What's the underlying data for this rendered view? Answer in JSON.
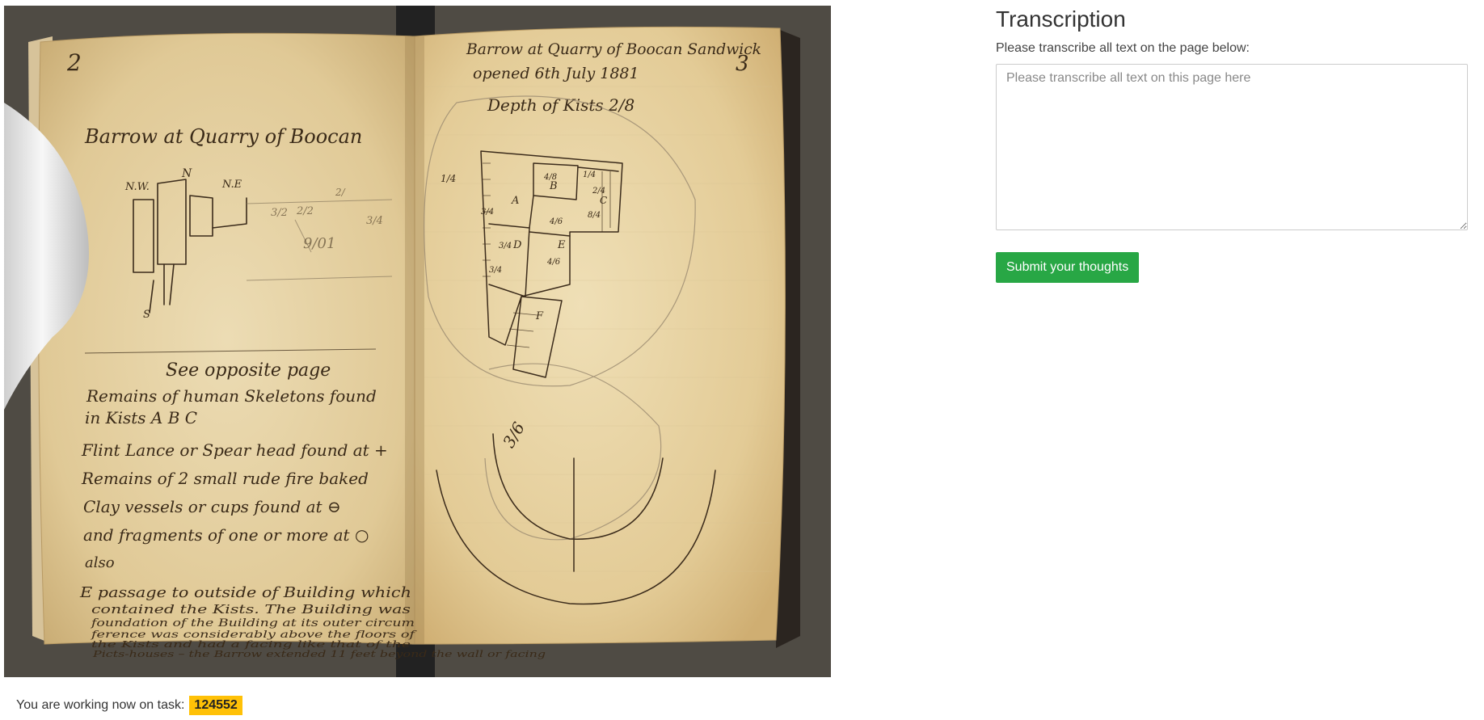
{
  "panel": {
    "title": "Transcription",
    "instructions": "Please transcribe all text on the page below:",
    "textarea_placeholder": "Please transcribe all text on this page here",
    "textarea_value": "",
    "submit_label": "Submit your thoughts"
  },
  "footer": {
    "working_label": "You are working now on task:",
    "task_id": "124552"
  },
  "manuscript": {
    "left_page": {
      "page_number": "2",
      "heading": "Barrow at Quarry of Boocan",
      "compass": [
        "N.W.",
        "N",
        "N.E",
        "S"
      ],
      "sketch_marks": [
        "2/",
        "3/2",
        "2/2",
        "3/4",
        "9/01"
      ],
      "see_note": "See opposite page",
      "notes": [
        "Remains of human Skeletons found",
        "in Kists A B C",
        "Flint Lance or Spear head found at +",
        "Remains of 2 small rude fire baked",
        "Clay vessels or cups found at ⊖",
        "and fragments of one or more at ○",
        "also",
        "E passage to outside of Building which",
        "contained the Kists. The Building was",
        "foundation of the Building at its outer circum",
        "ference was considerably above the floors of",
        "the Kists and had a facing like that of the",
        "Picts-houses – the Barrow extended 11 feet beyond the wall or facing"
      ]
    },
    "right_page": {
      "page_number": "3",
      "heading_line1": "Barrow at Quarry of Boocan Sandwick",
      "heading_line2": "opened 6th July 1881",
      "depth_note": "Depth of Kists 2/8",
      "kist_labels": [
        "A",
        "B",
        "C",
        "D",
        "E",
        "F"
      ],
      "measures": [
        "4/8",
        "1/4",
        "3/4",
        "3/4",
        "8/4",
        "2/4",
        "4/6",
        "4/6",
        "1/4",
        "3/4"
      ],
      "ring_note": "3/6"
    }
  }
}
